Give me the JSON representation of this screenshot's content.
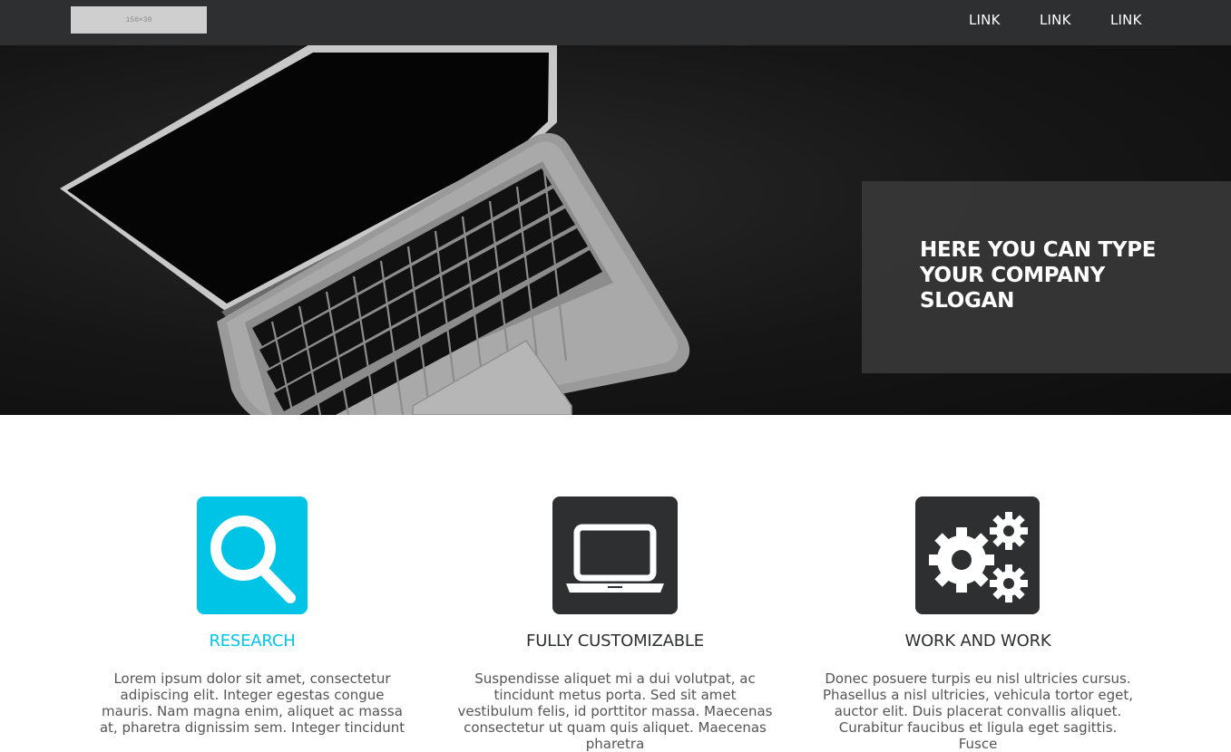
{
  "header": {
    "logo_text": "150×30",
    "links": [
      "LINK",
      "LINK",
      "LINK"
    ]
  },
  "hero": {
    "slogan": "HERE YOU CAN TYPE YOUR COMPANY SLOGAN"
  },
  "features": [
    {
      "icon": "search-icon",
      "title": "RESEARCH",
      "text": "Lorem ipsum dolor sit amet, consectetur adipiscing elit. Integer egestas congue mauris. Nam magna enim, aliquet ac massa at, pharetra dignissim sem. Integer tincidunt"
    },
    {
      "icon": "laptop-icon",
      "title": "FULLY CUSTOMIZABLE",
      "text": "Suspendisse aliquet mi a dui volutpat, ac tincidunt metus porta. Sed sit amet vestibulum felis, id porttitor massa. Maecenas consectetur ut quam quis aliquet. Maecenas pharetra"
    },
    {
      "icon": "gears-icon",
      "title": "WORK AND WORK",
      "text": "Donec posuere turpis eu nisl ultricies cursus. Phasellus a nisl ultricies, vehicula tortor eget, auctor elit. Duis placerat convallis aliquet. Curabitur faucibus et ligula eget sagittis. Fusce"
    }
  ],
  "colors": {
    "accent": "#00c4e6",
    "dark": "#2e2f30",
    "navbar": "#2e2f30"
  }
}
